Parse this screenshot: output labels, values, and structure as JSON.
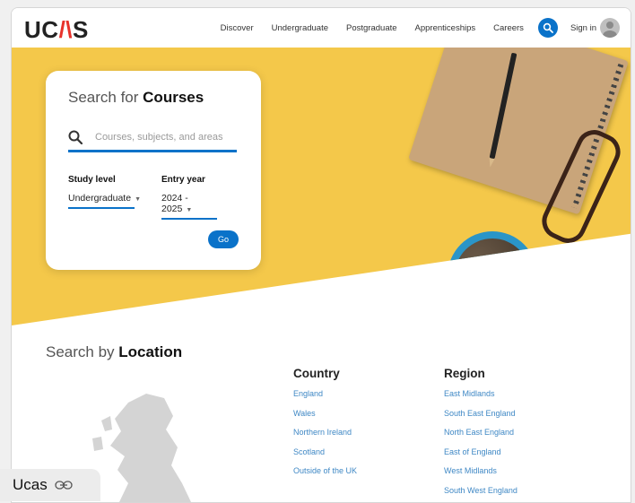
{
  "header": {
    "logo": "UCAS",
    "nav": [
      "Discover",
      "Undergraduate",
      "Postgraduate",
      "Apprenticeships",
      "Careers"
    ],
    "search_icon": "search-icon",
    "signin_label": "Sign in"
  },
  "search_card": {
    "title_prefix": "Search for ",
    "title_bold": "Courses",
    "search_placeholder": "Courses, subjects, and areas",
    "study_level_label": "Study level",
    "study_level_value": "Undergraduate",
    "entry_year_label": "Entry year",
    "entry_year_value": "2024 - 2025",
    "go_label": "Go"
  },
  "location": {
    "title_prefix": "Search by ",
    "title_bold": "Location",
    "country_heading": "Country",
    "countries": [
      "England",
      "Wales",
      "Northern Ireland",
      "Scotland",
      "Outside of the UK"
    ],
    "region_heading": "Region",
    "regions": [
      "East Midlands",
      "South East England",
      "North East England",
      "East of England",
      "West Midlands",
      "South West England"
    ]
  },
  "badge": {
    "label": "Ucas",
    "icon": "link-icon"
  },
  "colors": {
    "accent": "#0a72c9",
    "hero_bg": "#f4c84a",
    "link": "#3f88c5",
    "logo_wedge": "#e8322b"
  }
}
